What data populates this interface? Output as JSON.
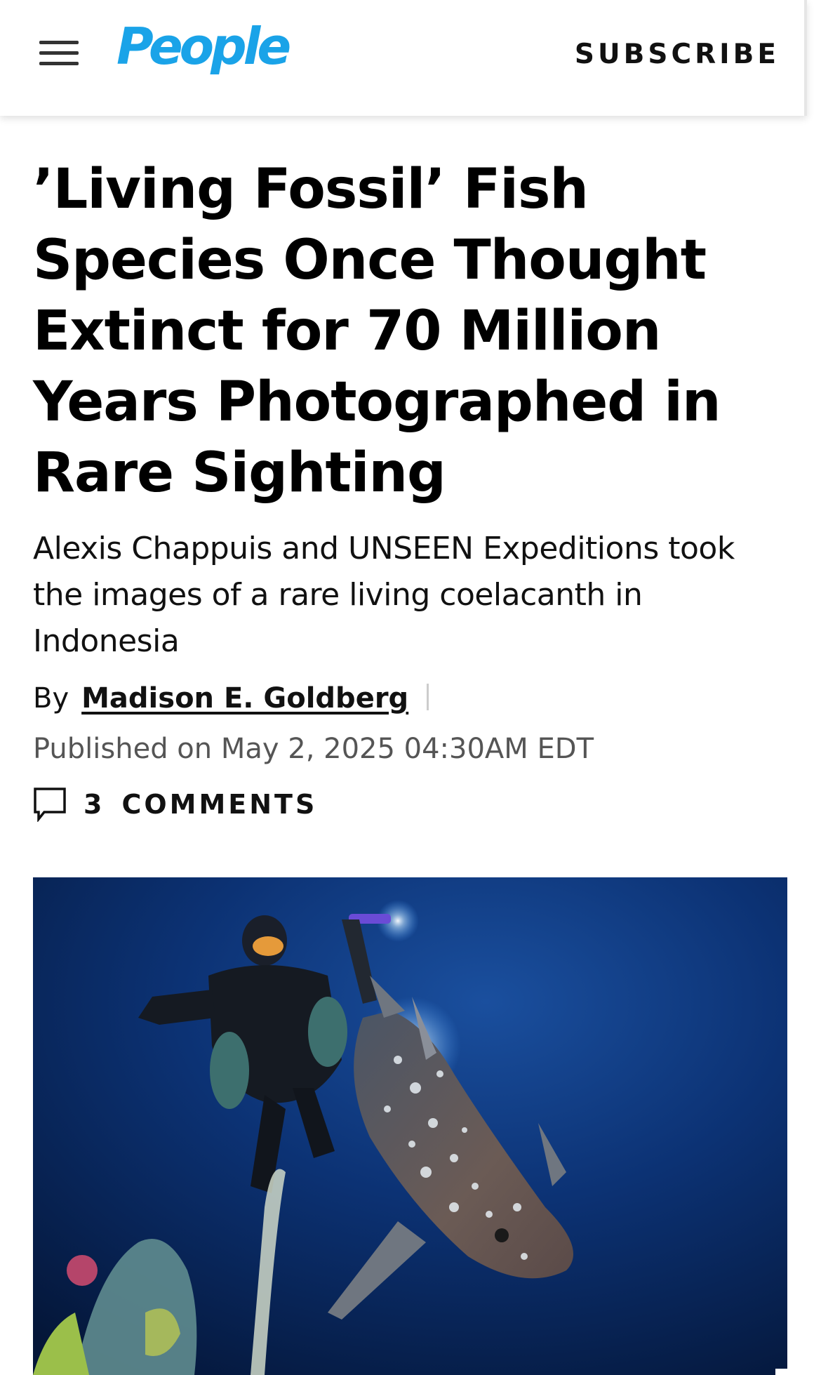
{
  "header": {
    "menu_icon": "hamburger-menu-icon",
    "logo": "People",
    "logo_color": "#1aa3e8",
    "subscribe_label": "SUBSCRIBE"
  },
  "article": {
    "headline": "’Living Fossil’ Fish Species Once Thought Extinct for 70 Million Years Photographed in Rare Sighting",
    "dek": "Alexis Chappuis and UNSEEN Expeditions took the images of a rare living coelacanth in Indonesia",
    "by_label": "By",
    "author": "Madison E. Goldberg",
    "published": "Published on May 2, 2025 04:30AM EDT",
    "comments_count": "3",
    "comments_label": "COMMENTS",
    "comments_icon": "speech-bubble-icon"
  },
  "hero_image": {
    "subject": "diver-and-coelacanth-photo",
    "background_color": "#0b2f6b"
  }
}
